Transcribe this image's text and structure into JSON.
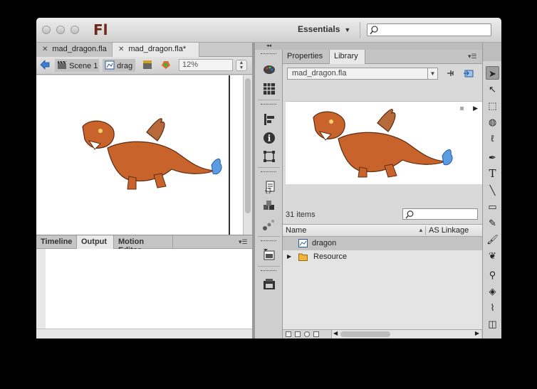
{
  "app": {
    "logo": "Fl",
    "workspace": "Essentials",
    "search_placeholder": ""
  },
  "doc_tabs": [
    {
      "label": "mad_dragon.fla",
      "active": false
    },
    {
      "label": "mad_dragon.fla*",
      "active": true
    }
  ],
  "edit_bar": {
    "scene": "Scene 1",
    "symbol": "drag",
    "zoom": "12%"
  },
  "bottom_tabs": [
    {
      "label": "Timeline",
      "active": false
    },
    {
      "label": "Output",
      "active": true
    },
    {
      "label": "Motion Editor",
      "active": false
    }
  ],
  "library": {
    "tabs": [
      {
        "label": "Properties",
        "active": false
      },
      {
        "label": "Library",
        "active": true
      }
    ],
    "document": "mad_dragon.fla",
    "count": "31 items",
    "col_name": "Name",
    "col_linkage": "AS Linkage",
    "items": [
      {
        "label": "dragon",
        "type": "movieclip-icon",
        "selected": true
      },
      {
        "label": "Resource",
        "type": "folder-icon",
        "selected": false
      }
    ]
  },
  "colors": {
    "window_bg": "#d6d6d6",
    "stage_bg": "#ffffff",
    "selection": "#c3c3c3",
    "logo": "#6b2a1a"
  },
  "icons": {
    "close": "close-icon",
    "back": "back-arrow-icon",
    "scene": "clapperboard-icon",
    "symbol": "symbol-icon",
    "edit_scene": "edit-scene-icon",
    "edit_symbol": "edit-symbol-icon",
    "search": "search-icon"
  },
  "tools": [
    "selection-tool-icon",
    "subselection-tool-icon",
    "free-transform-tool-icon",
    "3d-rotation-tool-icon",
    "lasso-tool-icon",
    "pen-tool-icon",
    "text-tool-icon",
    "line-tool-icon",
    "rectangle-tool-icon",
    "pencil-tool-icon",
    "brush-tool-icon",
    "deco-tool-icon",
    "bone-tool-icon",
    "paint-bucket-tool-icon",
    "eyedropper-tool-icon",
    "eraser-tool-icon"
  ],
  "tool_glyphs": {
    "text": "T"
  }
}
